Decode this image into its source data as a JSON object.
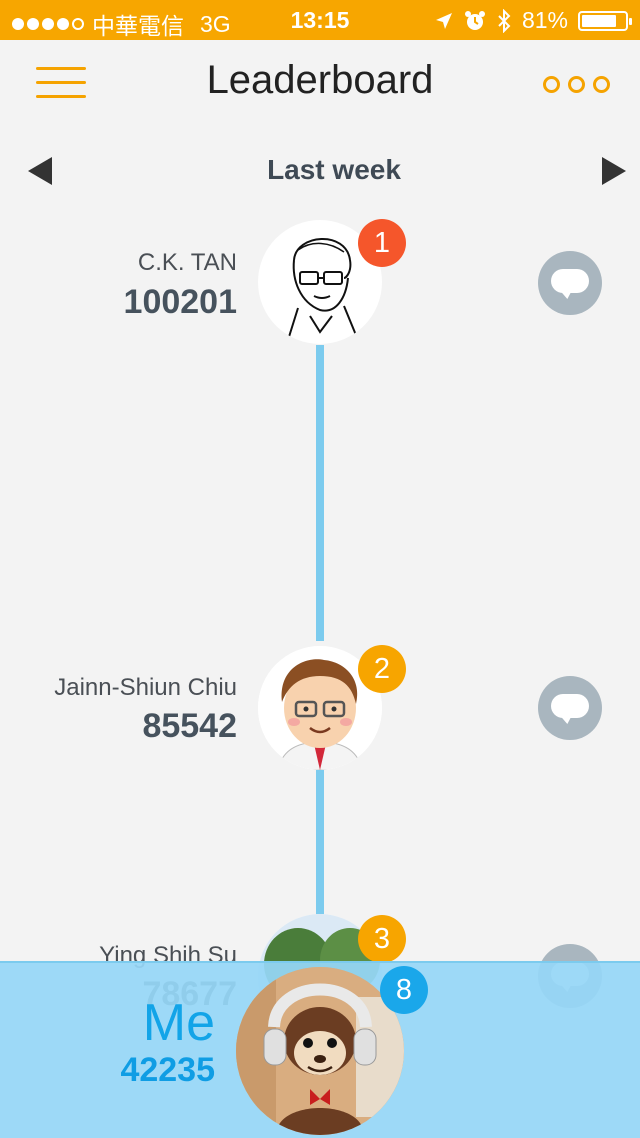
{
  "status_bar": {
    "carrier": "中華電信",
    "network": "3G",
    "time": "13:15",
    "battery": "81%",
    "battery_level": 0.81,
    "icons": [
      "location-icon",
      "alarm-icon",
      "bluetooth-icon"
    ]
  },
  "nav": {
    "title": "Leaderboard",
    "menu_icon": "hamburger-icon",
    "more_icon": "more-icon"
  },
  "period": {
    "label": "Last week",
    "prev_icon": "triangle-left-icon",
    "next_icon": "triangle-right-icon"
  },
  "leaders": [
    {
      "rank": "1",
      "name": "C.K. TAN",
      "score": "100201",
      "badge_color": "#f5562b",
      "avatar": "sketch-portrait"
    },
    {
      "rank": "2",
      "name": "Jainn-Shiun Chiu",
      "score": "85542",
      "badge_color": "#f7a500",
      "avatar": "cartoon-portrait"
    },
    {
      "rank": "3",
      "name": "Ying Shih Su",
      "score": "78677",
      "badge_color": "#f7a500",
      "avatar": "tree-photo"
    }
  ],
  "me": {
    "label": "Me",
    "rank": "8",
    "score": "42235",
    "avatar": "monkey-headphones-photo"
  },
  "colors": {
    "accent": "#f7a600",
    "timeline": "#7ccbee",
    "chat": "#a9b6bf",
    "me_panel": "#96d6f6",
    "me_text": "#12a4e8"
  }
}
